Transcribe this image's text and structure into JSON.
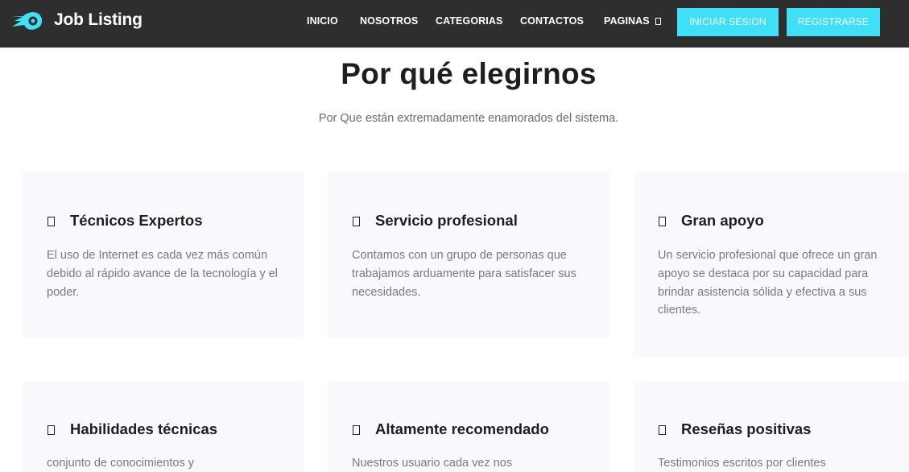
{
  "header": {
    "brand": "Job Listing",
    "logo_icon": "rocket-logo-icon",
    "accent_color": "#3fe0f6",
    "nav": [
      {
        "label": "INICIO"
      },
      {
        "label": "NOSOTROS"
      },
      {
        "label": "CATEGORIAS"
      },
      {
        "label": "CONTACTOS"
      },
      {
        "label": "PAGINAS",
        "icon": "chevron-down-icon"
      }
    ],
    "login_label": "INICIAR SESION",
    "register_label": "REGISTRARSE"
  },
  "section": {
    "title": "Por qué elegirnos",
    "subtitle": "Por Que están extremadamente enamorados del sistema."
  },
  "cards": [
    {
      "title": "Técnicos Expertos",
      "text": "El uso de Internet es cada vez más común debido al rápido avance de la tecnología y el poder."
    },
    {
      "title": "Servicio profesional",
      "text": "Contamos con un grupo de personas que trabajamos arduamente para satisfacer sus necesidades."
    },
    {
      "title": "Gran apoyo",
      "text": "Un servicio profesional que ofrece un gran apoyo se destaca por su capacidad para brindar asistencia sólida y efectiva a sus clientes."
    },
    {
      "title": "Habilidades técnicas",
      "text": "conjunto de conocimientos y"
    },
    {
      "title": "Altamente recomendado",
      "text": "Nuestros usuario cada vez nos"
    },
    {
      "title": "Reseñas positivas",
      "text": "Testimonios escritos por clientes"
    }
  ]
}
